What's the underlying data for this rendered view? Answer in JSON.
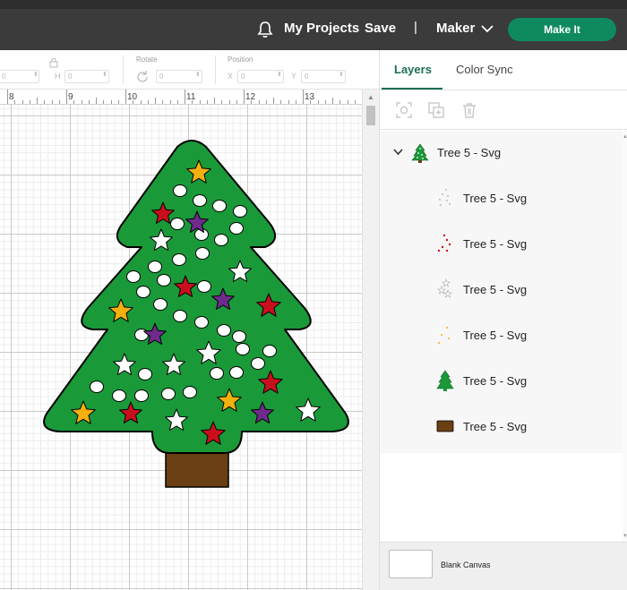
{
  "header": {
    "my_projects": "My Projects",
    "save": "Save",
    "separator": "|",
    "machine": "Maker",
    "make_it": "Make It"
  },
  "toolbar": {
    "rotate_label": "Rotate",
    "position_label": "Position",
    "size_field_1": "0",
    "height_letter": "H",
    "height_value": "0",
    "rotate_value": "0",
    "x_letter": "X",
    "x_value": "0",
    "y_letter": "Y",
    "y_value": "0"
  },
  "ruler": {
    "marks": [
      "8",
      "9",
      "10",
      "11",
      "12",
      "13"
    ]
  },
  "panel": {
    "tabs": [
      {
        "label": "Layers",
        "active": true
      },
      {
        "label": "Color Sync",
        "active": false
      }
    ],
    "group": {
      "name": "Tree 5 - Svg"
    },
    "layers": [
      {
        "name": "Tree 5 - Svg",
        "icon": "white-dots-icon"
      },
      {
        "name": "Tree 5 - Svg",
        "icon": "red-stars-icon"
      },
      {
        "name": "Tree 5 - Svg",
        "icon": "white-stars-icon"
      },
      {
        "name": "Tree 5 - Svg",
        "icon": "gold-stars-icon"
      },
      {
        "name": "Tree 5 - Svg",
        "icon": "green-tree-icon"
      },
      {
        "name": "Tree 5 - Svg",
        "icon": "brown-trunk-icon"
      }
    ],
    "blank_canvas": "Blank Canvas"
  },
  "colors": {
    "brand_green": "#0f8a5f",
    "tree_green": "#1a9939",
    "trunk_brown": "#6b3f14",
    "star_gold": "#f4b00e",
    "star_red": "#c8101c",
    "star_purple": "#6e2b8c",
    "header_bg": "#3b3b3b"
  }
}
